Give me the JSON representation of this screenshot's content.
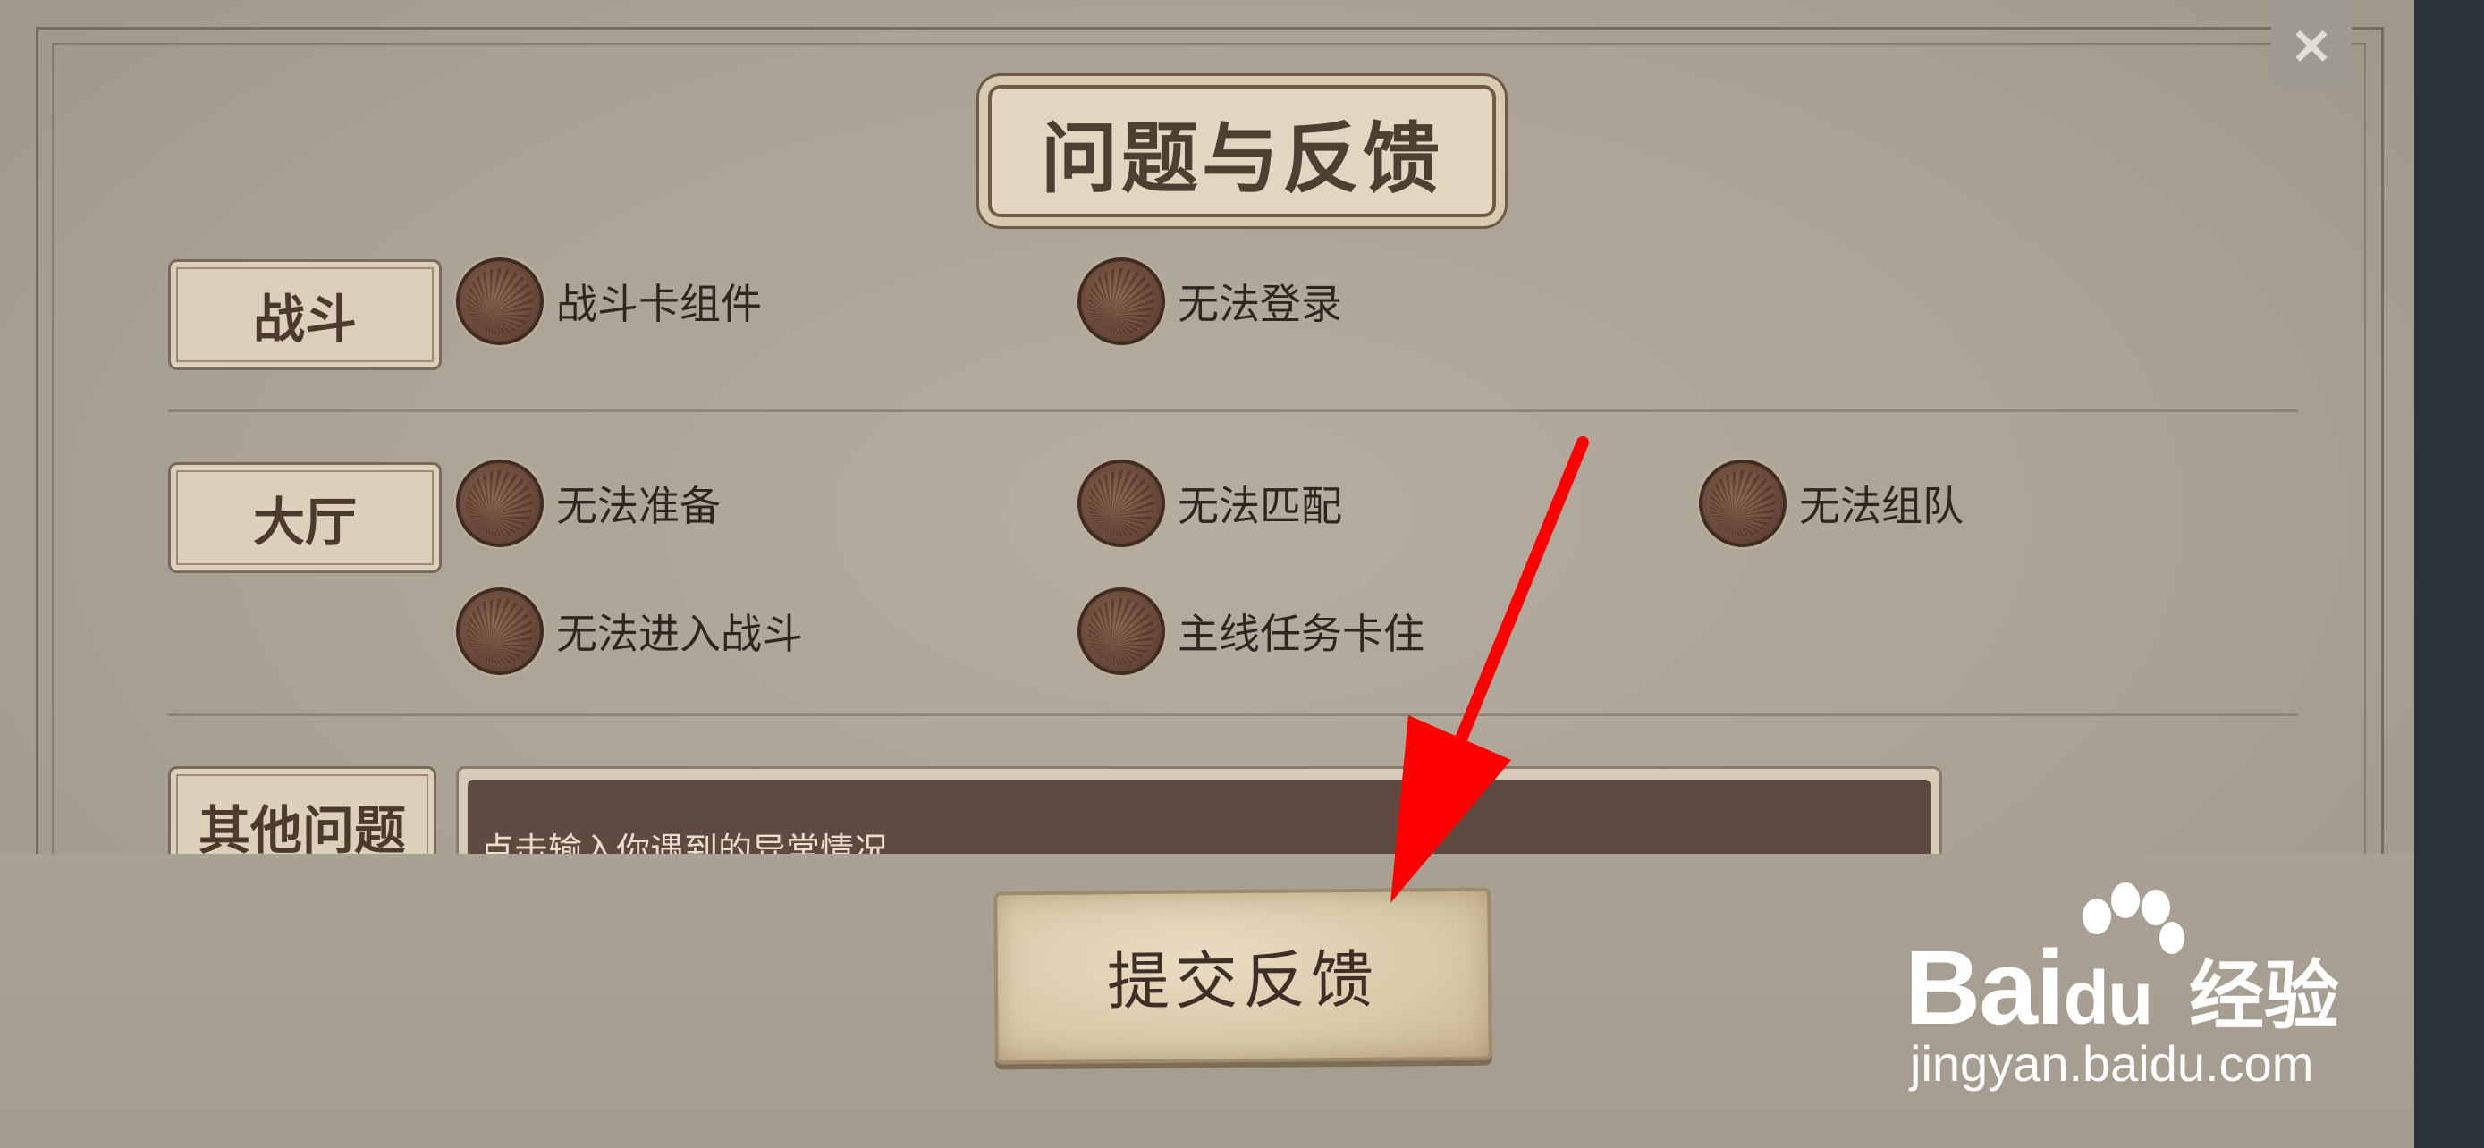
{
  "dialog": {
    "title": "问题与反馈",
    "close_symbol": "×",
    "categories": [
      {
        "label": "战斗",
        "options": [
          {
            "label": "战斗卡组件",
            "icon": "radio-disc-icon"
          },
          {
            "label": "无法登录",
            "icon": "radio-disc-icon"
          }
        ]
      },
      {
        "label": "大厅",
        "options": [
          {
            "label": "无法准备",
            "icon": "radio-disc-icon"
          },
          {
            "label": "无法匹配",
            "icon": "radio-disc-icon"
          },
          {
            "label": "无法组队",
            "icon": "radio-disc-icon"
          },
          {
            "label": "无法进入战斗",
            "icon": "radio-disc-icon"
          },
          {
            "label": "主线任务卡住",
            "icon": "radio-disc-icon"
          }
        ]
      },
      {
        "label": "其他问题",
        "input_placeholder": "点击输入你遇到的异常情况"
      }
    ],
    "submit_label": "提交反馈"
  },
  "watermark": {
    "brand": "Bai",
    "brand_suffix": "du",
    "brand_cn": "经验",
    "url": "jingyan.baidu.com"
  },
  "colors": {
    "panel": "#aaa294",
    "plate": "#ddd0bb",
    "radio": "#6e4c3c",
    "input_bg": "#5f4a41",
    "arrow": "#ff0000"
  }
}
